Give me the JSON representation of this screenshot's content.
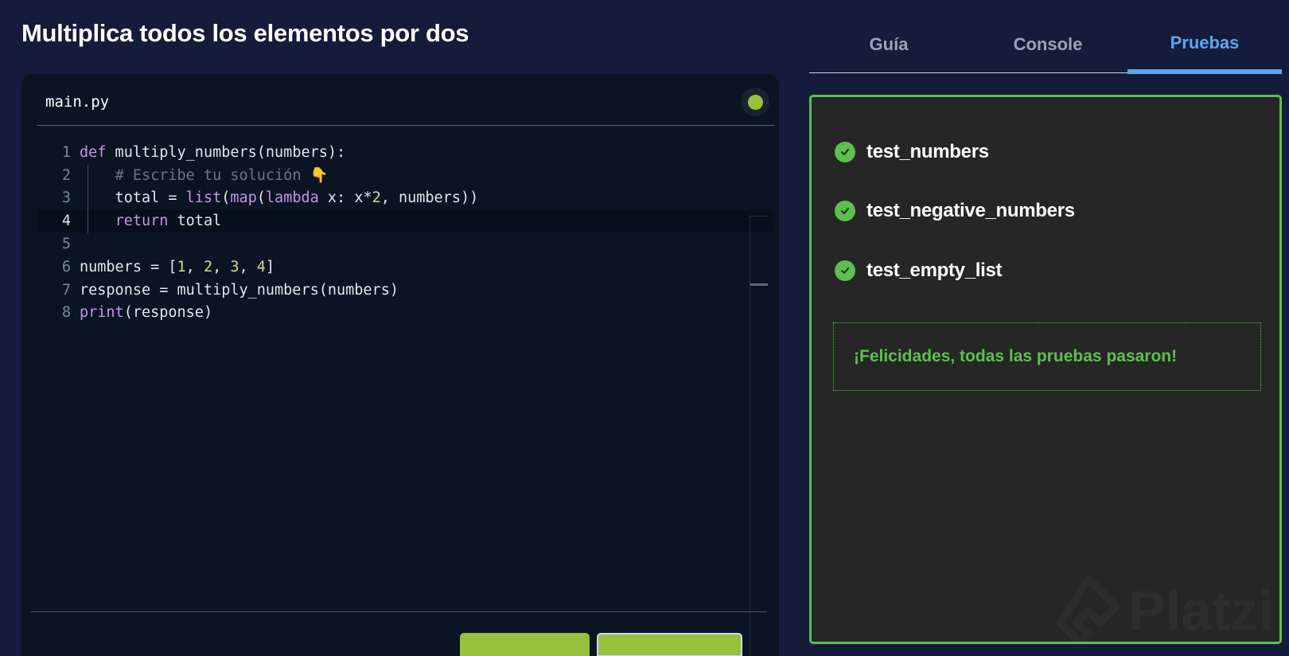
{
  "page": {
    "title": "Multiplica todos los elementos por dos"
  },
  "editor": {
    "filename": "main.py",
    "status_color": "#98c03a",
    "active_line": 4,
    "lines": [
      {
        "n": "1",
        "html": "<span class=\"kw\">def</span> multiply_numbers(numbers):"
      },
      {
        "n": "2",
        "html": "    <span class=\"cmt\"># Escribe tu solución 👇</span>"
      },
      {
        "n": "3",
        "html": "    total = <span class=\"bi\">list</span>(<span class=\"bi\">map</span>(<span class=\"kw\">lambda</span> x: x*<span class=\"num\">2</span>, numbers))"
      },
      {
        "n": "4",
        "html": "    <span class=\"kw\">return</span> total"
      },
      {
        "n": "5",
        "html": ""
      },
      {
        "n": "6",
        "html": "numbers = [<span class=\"num\">1</span>, <span class=\"num\">2</span>, <span class=\"num\">3</span>, <span class=\"num\">4</span>]"
      },
      {
        "n": "7",
        "html": "response = multiply_numbers(numbers)"
      },
      {
        "n": "8",
        "html": "<span class=\"bi\">print</span>(response)"
      }
    ],
    "buttons": {
      "run_label": "",
      "submit_label": ""
    }
  },
  "tabs": {
    "items": [
      {
        "label": "Guía",
        "active": false
      },
      {
        "label": "Console",
        "active": false
      },
      {
        "label": "Pruebas",
        "active": true
      }
    ],
    "active_color": "#5aa7f0"
  },
  "tests": {
    "items": [
      {
        "name": "test_numbers",
        "status": "passed"
      },
      {
        "name": "test_negative_numbers",
        "status": "passed"
      },
      {
        "name": "test_empty_list",
        "status": "passed"
      }
    ],
    "success_message": "¡Felicidades, todas las pruebas pasaron!",
    "success_color": "#5cc04e"
  },
  "watermark": {
    "brand": "Platzi",
    "icon": "platzi-logo-icon"
  }
}
